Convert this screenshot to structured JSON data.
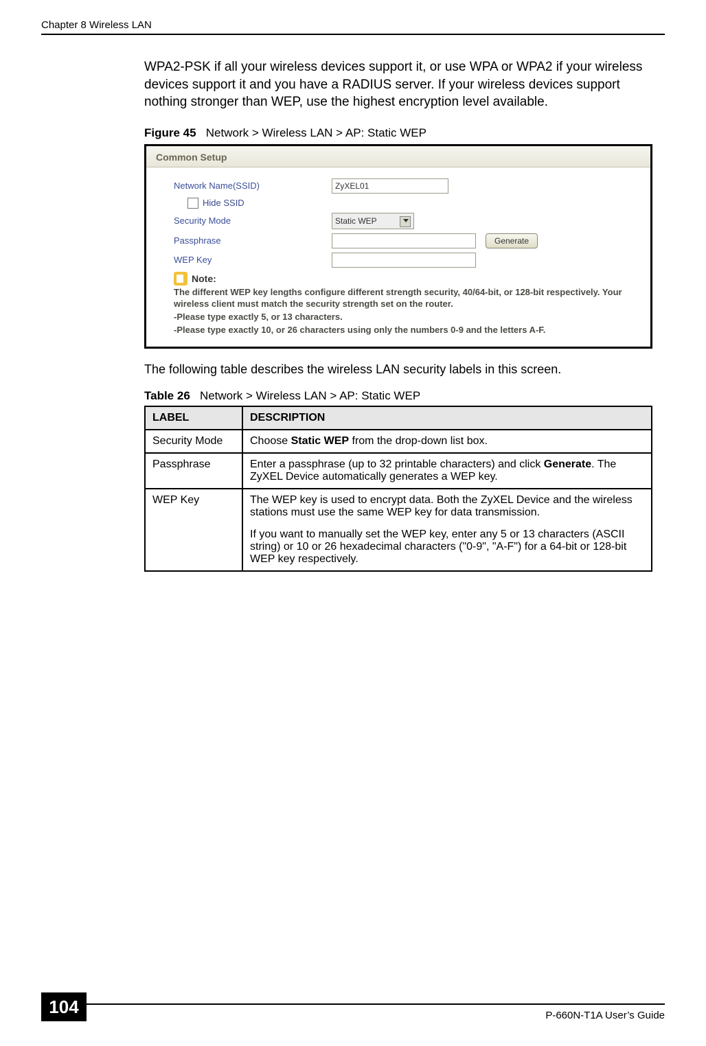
{
  "header": {
    "chapter": "Chapter 8 Wireless LAN"
  },
  "intro_paragraph": "WPA2-PSK if all your wireless devices support it, or use WPA or WPA2 if your wireless devices support it and you have a RADIUS server. If your wireless devices support nothing stronger than WEP, use the highest encryption level available.",
  "figure": {
    "label": "Figure 45",
    "title": "Network > Wireless LAN > AP: Static WEP"
  },
  "screenshot": {
    "group_title": "Common Setup",
    "ssid_label": "Network Name(SSID)",
    "ssid_value": "ZyXEL01",
    "hide_ssid_label": "Hide SSID",
    "security_mode_label": "Security Mode",
    "security_mode_value": "Static WEP",
    "passphrase_label": "Passphrase",
    "passphrase_value": "",
    "generate_btn": "Generate",
    "wepkey_label": "WEP Key",
    "wepkey_value": "",
    "note_label": "Note:",
    "note_line1": "The different WEP key lengths configure different strength security, 40/64-bit, or 128-bit respectively. Your wireless client must match the security strength set on the router.",
    "note_line2": "-Please type exactly 5, or 13 characters.",
    "note_line3": "-Please type exactly 10, or 26 characters using only the numbers 0-9 and the letters A-F."
  },
  "post_figure_text": "The following table describes the wireless LAN security labels in this screen.",
  "table_caption": {
    "label": "Table 26",
    "title": "Network > Wireless LAN > AP: Static WEP"
  },
  "table": {
    "head_label": "LABEL",
    "head_desc": "DESCRIPTION",
    "rows": [
      {
        "label": "Security Mode",
        "desc_pre": "Choose ",
        "desc_bold": "Static WEP",
        "desc_post": " from the drop-down list box."
      },
      {
        "label": "Passphrase",
        "desc_pre": "Enter a passphrase (up to 32 printable characters) and click ",
        "desc_bold": "Generate",
        "desc_post": ". The ZyXEL Device automatically generates a WEP key."
      },
      {
        "label": "WEP Key",
        "desc_plain": "The WEP key is used to encrypt data. Both the ZyXEL Device and the wireless stations must use the same WEP key for data transmission.",
        "desc_plain2": "If you want to manually set the WEP key, enter any 5 or 13 characters (ASCII string) or 10 or 26 hexadecimal characters (\"0-9\", \"A-F\") for a 64-bit or 128-bit WEP key respectively."
      }
    ]
  },
  "footer": {
    "page_number": "104",
    "guide": "P-660N-T1A User’s Guide"
  }
}
